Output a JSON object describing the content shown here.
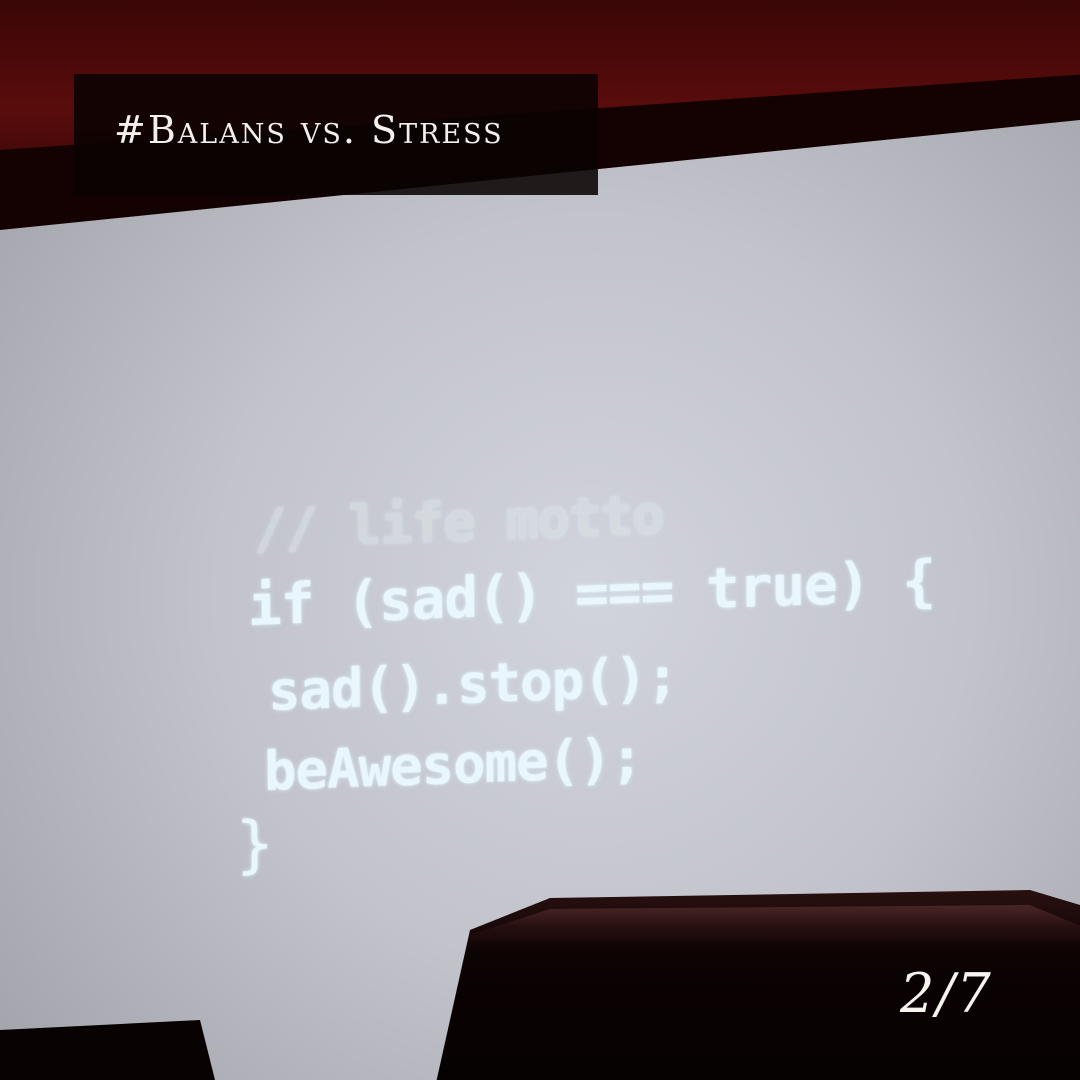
{
  "title": "#Balans vs. Stress",
  "code": {
    "comment": "// life motto",
    "line1": "if (sad() === true) {",
    "line2": "sad().stop();",
    "line3": "beAwesome();",
    "line4": "}"
  },
  "page_indicator": "2/7",
  "colors": {
    "title_box": "#0a0202",
    "title_text": "#f4f0ea",
    "screen": "#c2c3cb",
    "code_text": "#e9f6fb",
    "background_red": "#5a0c0c"
  }
}
